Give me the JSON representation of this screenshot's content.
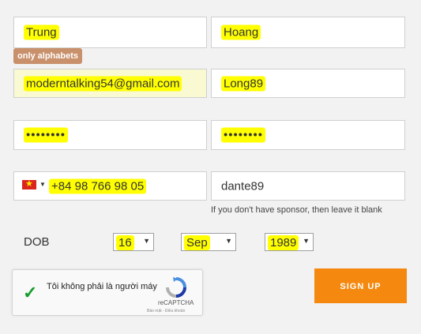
{
  "first_name": {
    "value": "Trung"
  },
  "last_name": {
    "value": "Hoang"
  },
  "tooltip": {
    "text": "only alphabets"
  },
  "email": {
    "value": "moderntalking54@gmail.com"
  },
  "username": {
    "value": "Long89"
  },
  "password": {
    "value": "••••••••"
  },
  "confirm_password": {
    "value": "••••••••"
  },
  "phone": {
    "country_flag": "vietnam-flag-icon",
    "value": "+84 98 766 98 05"
  },
  "sponsor": {
    "value": "dante89",
    "hint": "If you don't have sponsor, then leave it blank"
  },
  "dob": {
    "label": "DOB",
    "day": "16",
    "month": "Sep",
    "year": "1989"
  },
  "captcha": {
    "label": "Tôi không phải là người máy",
    "brand": "reCAPTCHA",
    "terms": "Bảo mật - Điều khoản"
  },
  "signup": {
    "label": "SIGN UP"
  },
  "colors": {
    "accent": "#f5890f",
    "highlight": "#ffff00",
    "tooltip": "#c8906b"
  }
}
